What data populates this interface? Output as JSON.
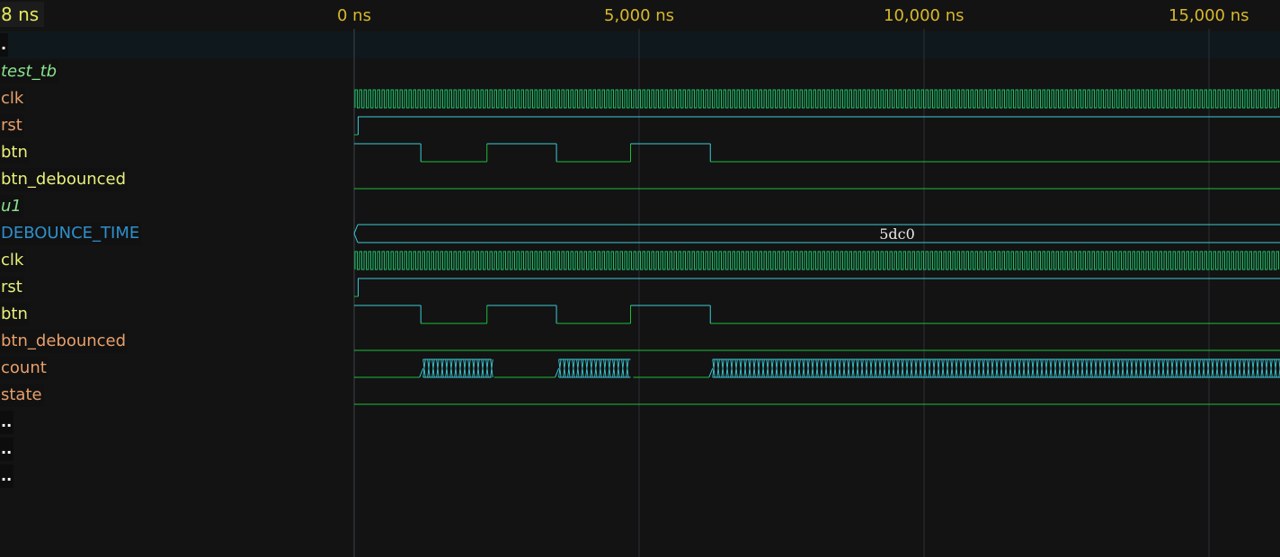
{
  "cursor_time": "8 ns",
  "timeline": {
    "ticks": [
      {
        "label": "0 ns",
        "t": 0
      },
      {
        "label": "5,000 ns",
        "t": 5000
      },
      {
        "label": "10,000 ns",
        "t": 10000
      },
      {
        "label": "15,000 ns",
        "t": 15000
      }
    ]
  },
  "signals": [
    {
      "label": ".",
      "kind": "dots",
      "color": "#ffffff"
    },
    {
      "label": "test_tb",
      "kind": "scope",
      "color": "#8ae28f"
    },
    {
      "label": "clk",
      "kind": "signal",
      "color": "#e8a06b",
      "wave": "clock"
    },
    {
      "label": "rst",
      "kind": "signal",
      "color": "#e8a06b",
      "wave": "rst"
    },
    {
      "label": "btn",
      "kind": "signal",
      "color": "#e8f07a",
      "wave": "btn"
    },
    {
      "label": "btn_debounced",
      "kind": "signal",
      "color": "#e8f07a",
      "wave": "low"
    },
    {
      "label": "u1",
      "kind": "scope",
      "color": "#8ae28f"
    },
    {
      "label": "DEBOUNCE_TIME",
      "kind": "param",
      "color": "#2f8fcc",
      "wave": "bus",
      "value": "5dc0"
    },
    {
      "label": "clk",
      "kind": "signal",
      "color": "#e8f07a",
      "wave": "clock"
    },
    {
      "label": "rst",
      "kind": "signal",
      "color": "#e8f07a",
      "wave": "rst"
    },
    {
      "label": "btn",
      "kind": "signal",
      "color": "#e8f07a",
      "wave": "btn"
    },
    {
      "label": "btn_debounced",
      "kind": "signal",
      "color": "#e8a06b",
      "wave": "low"
    },
    {
      "label": "count",
      "kind": "signal",
      "color": "#e8a06b",
      "wave": "count"
    },
    {
      "label": "state",
      "kind": "signal",
      "color": "#e8a06b",
      "wave": "low"
    },
    {
      "label": "..",
      "kind": "dots",
      "color": "#ffffff"
    },
    {
      "label": "..",
      "kind": "dots",
      "color": "#ffffff"
    },
    {
      "label": "..",
      "kind": "dots",
      "color": "#ffffff"
    }
  ],
  "waves": {
    "rst_release_ns": 70,
    "btn_transitions_ns": [
      1170,
      2330,
      3550,
      4850,
      6250
    ],
    "count_active_ns": [
      [
        1210,
        2410
      ],
      [
        3590,
        4850
      ],
      [
        6290,
        16300
      ]
    ]
  },
  "colors": {
    "high": "#3ccbd6",
    "low": "#1bbf3a",
    "clock": "#1dc06a",
    "grid": "#2b3236",
    "zero_line": "#3a454b"
  }
}
